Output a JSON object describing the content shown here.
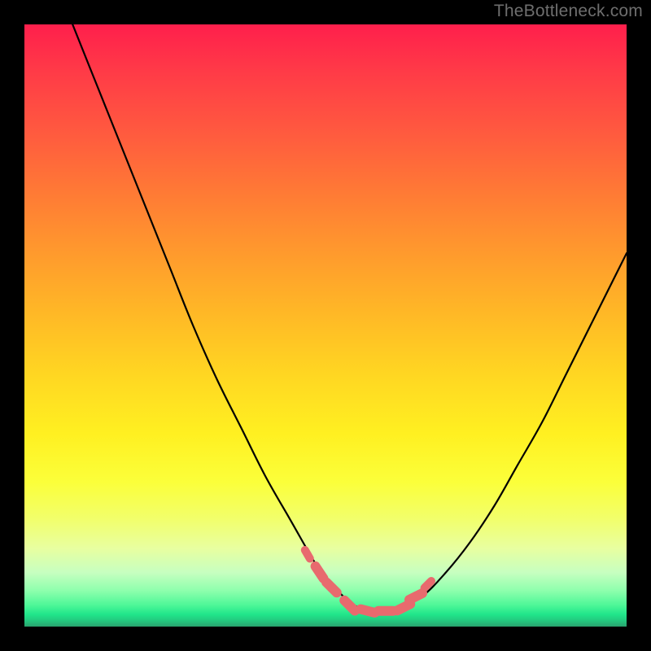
{
  "watermark": "TheBottleneck.com",
  "chart_data": {
    "type": "line",
    "title": "",
    "xlabel": "",
    "ylabel": "",
    "xlim": [
      0,
      100
    ],
    "ylim": [
      0,
      100
    ],
    "grid": false,
    "legend": false,
    "background_gradient": {
      "top": "#ff1f4c",
      "middle": "#fff021",
      "bottom": "#29a36e"
    },
    "series": [
      {
        "name": "bottleneck-curve",
        "color": "#000000",
        "x": [
          8,
          12,
          16,
          20,
          24,
          28,
          32,
          36,
          40,
          44,
          48,
          50,
          52,
          54,
          56,
          58,
          60,
          62,
          66,
          70,
          74,
          78,
          82,
          86,
          90,
          94,
          98,
          100
        ],
        "y": [
          100,
          90,
          80,
          70,
          60,
          50,
          41,
          33,
          25,
          18,
          11,
          8,
          6,
          4,
          3,
          2.5,
          2.5,
          3,
          5,
          9,
          14,
          20,
          27,
          34,
          42,
          50,
          58,
          62
        ]
      }
    ],
    "markers": {
      "name": "highlighted-range",
      "color": "#e86a6e",
      "x": [
        47,
        49,
        51,
        54,
        57,
        60,
        63,
        65,
        67
      ],
      "y": [
        12,
        9,
        6.5,
        3.5,
        2.6,
        2.6,
        3.2,
        5,
        7
      ]
    }
  }
}
